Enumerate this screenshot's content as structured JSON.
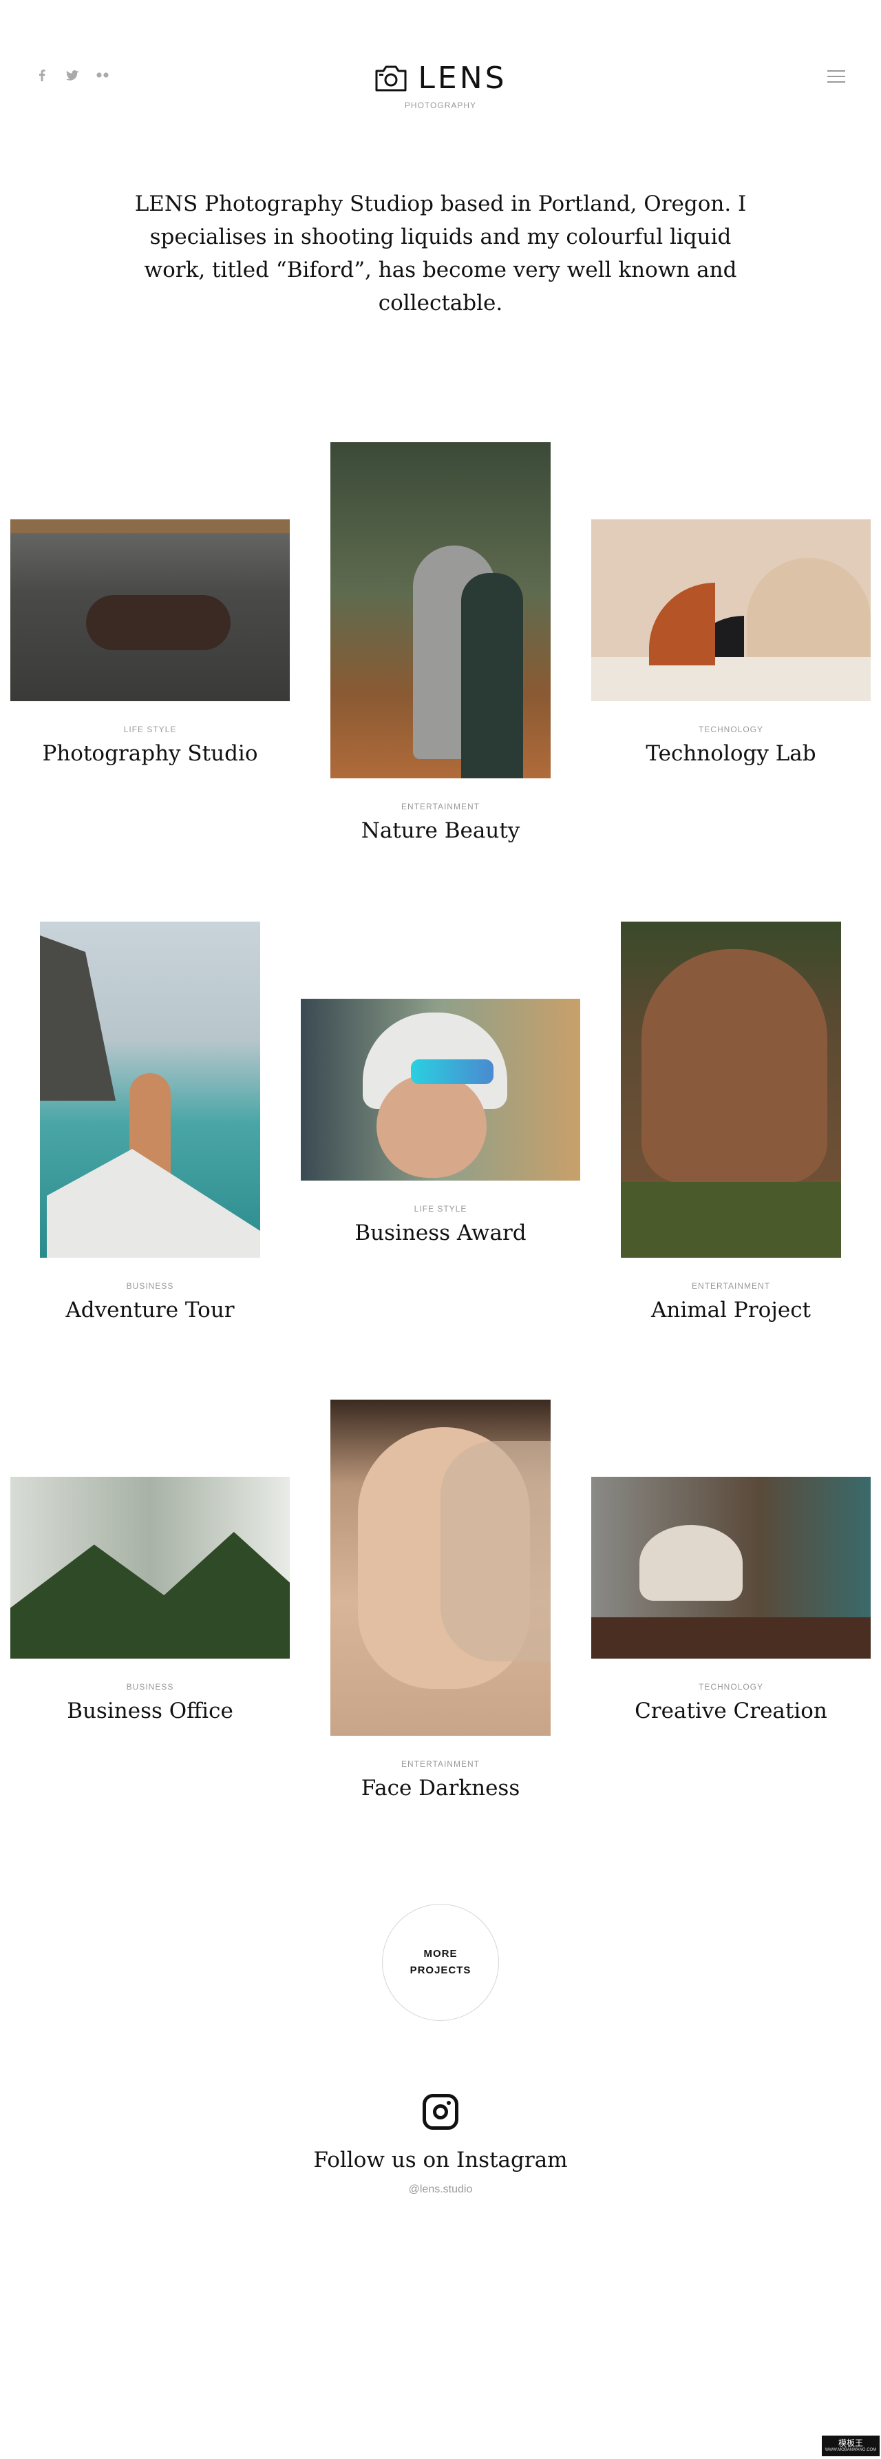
{
  "header": {
    "logo_text": "LENS",
    "logo_sub": "PHOTOGRAPHY",
    "social_icons": [
      "facebook-icon",
      "twitter-icon",
      "flickr-icon"
    ],
    "menu_icon": "hamburger-menu-icon"
  },
  "intro": {
    "text": "LENS Photography Studiop based in Portland, Oregon. I specialises in shooting liquids and my colourful liquid work, titled “Biford”, has become very well known and collectable."
  },
  "projects": [
    {
      "category": "LIFE STYLE",
      "title": "Photography Studio",
      "image": "man-sleeping-on-sofa"
    },
    {
      "category": "ENTERTAINMENT",
      "title": "Nature Beauty",
      "image": "couple-in-forest"
    },
    {
      "category": "TECHNOLOGY",
      "title": "Technology Lab",
      "image": "arch-shapes-still-life"
    },
    {
      "category": "BUSINESS",
      "title": "Adventure Tour",
      "image": "man-on-boat-bow"
    },
    {
      "category": "LIFE STYLE",
      "title": "Business Award",
      "image": "cyclist-with-sunglasses"
    },
    {
      "category": "ENTERTAINMENT",
      "title": "Animal Project",
      "image": "elephant"
    },
    {
      "category": "BUSINESS",
      "title": "Business Office",
      "image": "office-with-plants"
    },
    {
      "category": "ENTERTAINMENT",
      "title": "Face Darkness",
      "image": "woman-face-portrait"
    },
    {
      "category": "TECHNOLOGY",
      "title": "Creative Creation",
      "image": "coffee-cup-street"
    }
  ],
  "more_button": {
    "label": "MORE\nPROJECTS"
  },
  "instagram": {
    "icon": "instagram-icon",
    "title": "Follow us on Instagram",
    "handle": "@lens.studio"
  },
  "watermark": {
    "main": "模板王",
    "sub": "WWW.MOBANWANG.COM"
  }
}
